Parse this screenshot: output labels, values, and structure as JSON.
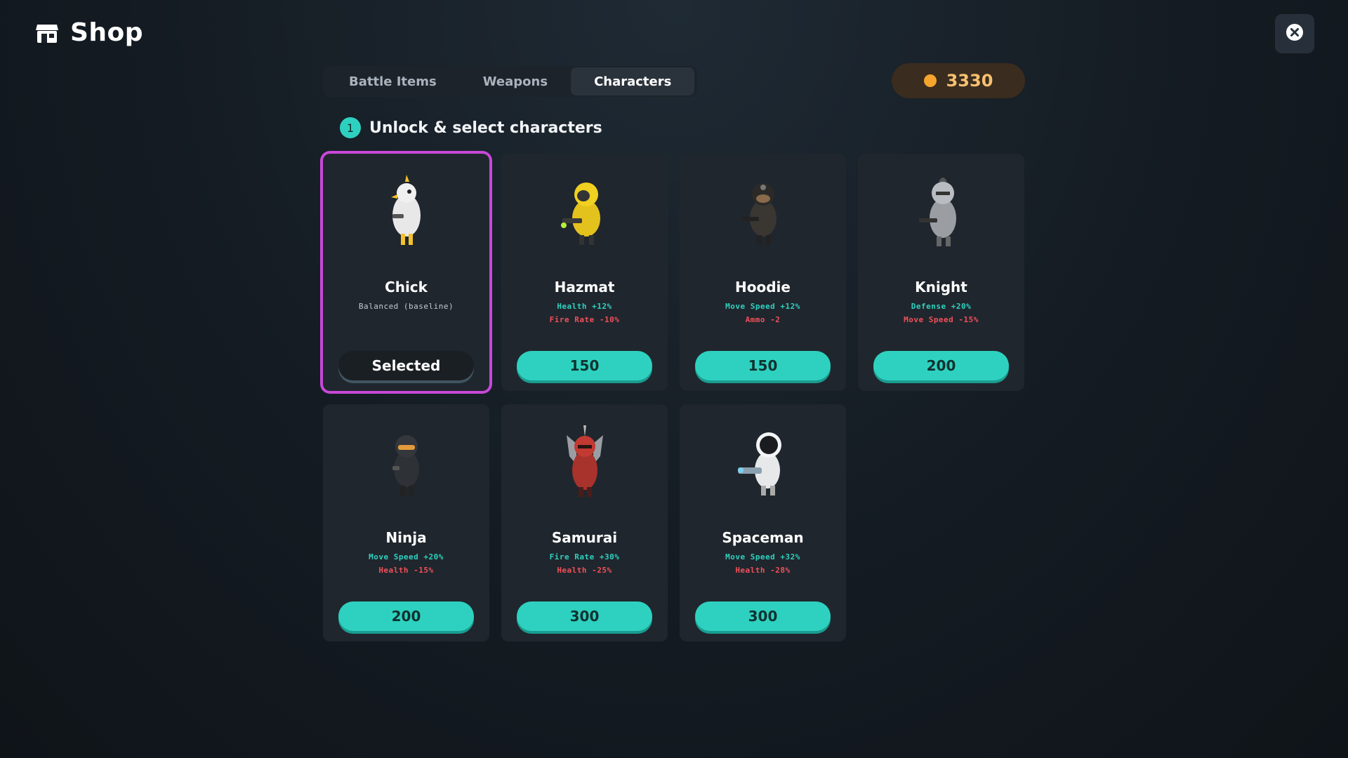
{
  "header": {
    "title": "Shop",
    "icon": "store-icon"
  },
  "close": {
    "icon": "close-icon"
  },
  "tabs": [
    {
      "label": "Battle Items",
      "active": false
    },
    {
      "label": "Weapons",
      "active": false
    },
    {
      "label": "Characters",
      "active": true
    }
  ],
  "currency": {
    "amount": "3330",
    "icon": "coin-icon",
    "color": "#f5a52e"
  },
  "section": {
    "step": "1",
    "label": "Unlock & select characters"
  },
  "colors": {
    "accent": "#2ed1c0",
    "selected_border": "#c748d8",
    "negative": "#f0505a"
  },
  "characters": [
    {
      "name": "Chick",
      "stat1": "Balanced (baseline)",
      "stat2": "",
      "button": "Selected",
      "selected": true
    },
    {
      "name": "Hazmat",
      "stat1": "Health +12%",
      "stat2": "Fire Rate -10%",
      "button": "150",
      "selected": false
    },
    {
      "name": "Hoodie",
      "stat1": "Move Speed +12%",
      "stat2": "Ammo -2",
      "button": "150",
      "selected": false
    },
    {
      "name": "Knight",
      "stat1": "Defense +20%",
      "stat2": "Move Speed -15%",
      "button": "200",
      "selected": false
    },
    {
      "name": "Ninja",
      "stat1": "Move Speed +20%",
      "stat2": "Health -15%",
      "button": "200",
      "selected": false
    },
    {
      "name": "Samurai",
      "stat1": "Fire Rate +30%",
      "stat2": "Health -25%",
      "button": "300",
      "selected": false
    },
    {
      "name": "Spaceman",
      "stat1": "Move Speed +32%",
      "stat2": "Health -28%",
      "button": "300",
      "selected": false
    }
  ]
}
